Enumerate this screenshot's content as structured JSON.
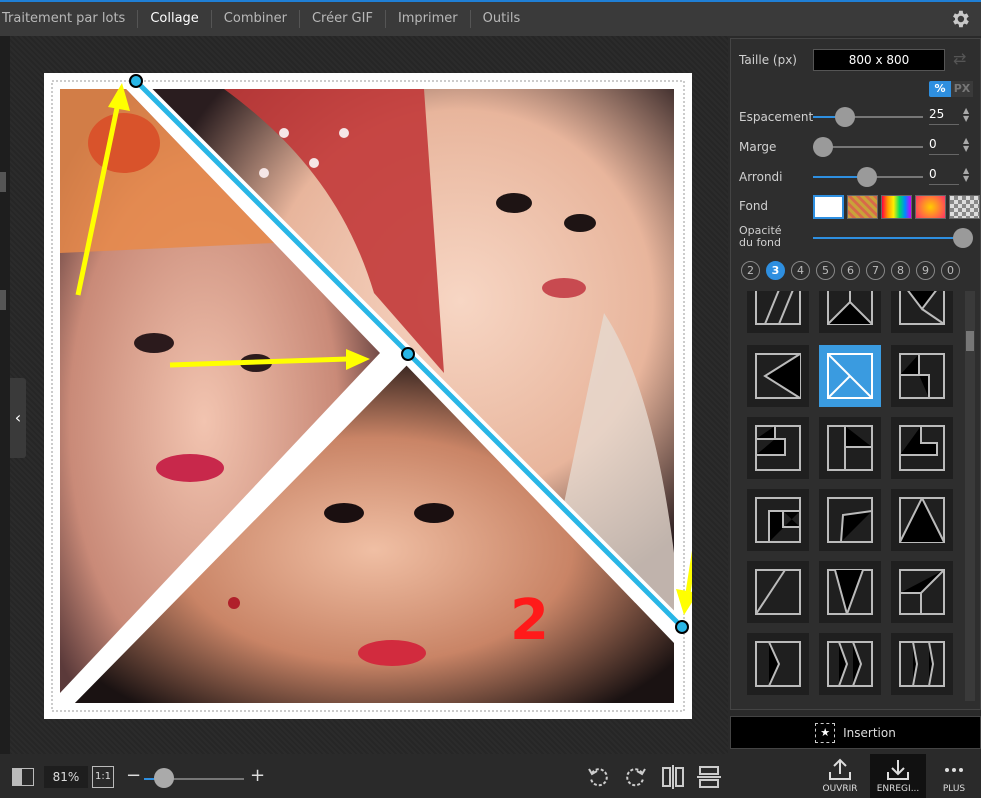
{
  "menu": {
    "items": [
      "Traitement par lots",
      "Collage",
      "Combiner",
      "Créer GIF",
      "Imprimer",
      "Outils"
    ],
    "active_index": 1
  },
  "panel": {
    "size_label": "Taille (px)",
    "size_value": "800 x 800",
    "unit_pct": "%",
    "unit_px": "PX",
    "spacing_label": "Espacement",
    "spacing_value": "25",
    "margin_label": "Marge",
    "margin_value": "0",
    "rounding_label": "Arrondi",
    "rounding_value": "0",
    "background_label": "Fond",
    "opacity_label_line1": "Opacité",
    "opacity_label_line2": "du fond",
    "image_counts": [
      "2",
      "3",
      "4",
      "5",
      "6",
      "7",
      "8",
      "9",
      "0"
    ],
    "active_count": "3",
    "accent_color": "#2e8fe0"
  },
  "insert": {
    "label": "Insertion"
  },
  "collage": {
    "annotation_number": "2",
    "line_color": "#29b6e6",
    "arrow_color": "#ffff00"
  },
  "bottombar": {
    "zoom_value": "81%",
    "one_to_one": "1:1",
    "open_label": "OUVRIR",
    "save_label": "ENREGI...",
    "more_label": "PLUS"
  }
}
